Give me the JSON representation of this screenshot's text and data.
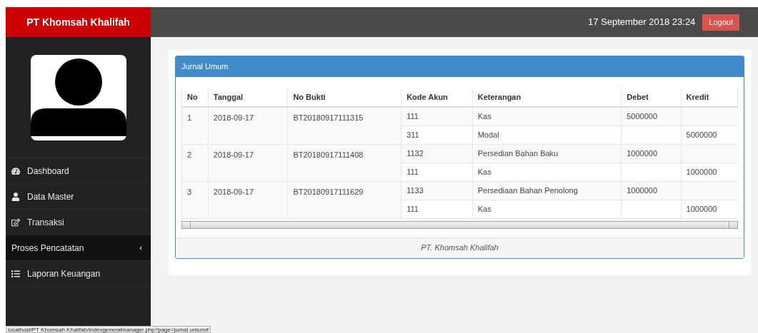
{
  "brand": "PT Khomsah Khalifah",
  "header": {
    "datetime": "17 September 2018 23:24",
    "logout": "Logout"
  },
  "sidebar": {
    "items": [
      {
        "label": "Dashboard",
        "kind": "link",
        "selected": false
      },
      {
        "label": "Data Master",
        "kind": "link",
        "selected": false
      },
      {
        "label": "Transaksi",
        "kind": "link",
        "selected": false
      },
      {
        "label": "Proses Pencatatan",
        "kind": "submenu",
        "selected": true
      },
      {
        "label": "Laporan Keuangan",
        "kind": "link",
        "selected": false
      }
    ]
  },
  "panel": {
    "title": "Jurnal Umum",
    "footer": "PT. Khomsah Khalifah",
    "table": {
      "columns": [
        "No",
        "Tanggal",
        "No Bukti",
        "Kode Akun",
        "Keterangan",
        "Debet",
        "Kredit"
      ],
      "entries": [
        {
          "no": "1",
          "date": "2018-09-17",
          "ref": "BT20180917111315",
          "lines": [
            {
              "account": "111",
              "description": "Kas",
              "debit": "5000000"
            },
            {
              "account": "311",
              "description": "Modal",
              "credit": "5000000"
            }
          ]
        },
        {
          "no": "2",
          "date": "2018-09-17",
          "ref": "BT20180917111408",
          "lines": [
            {
              "account": "1132",
              "description": "Persedian Bahan Baku",
              "debit": "1000000"
            },
            {
              "account": "111",
              "description": "Kas",
              "credit": "1000000"
            }
          ]
        },
        {
          "no": "3",
          "date": "2018-09-17",
          "ref": "BT20180917111629",
          "lines": [
            {
              "account": "1133",
              "description": "Persediaan Bahan Penolong",
              "debit": "1000000"
            },
            {
              "account": "111",
              "description": "Kas",
              "credit": "1000000"
            }
          ]
        }
      ]
    }
  },
  "status_bar": "localhost/PT Khomsah Khalifah/indexgeneralmanager.php?page=jurnal umum#"
}
